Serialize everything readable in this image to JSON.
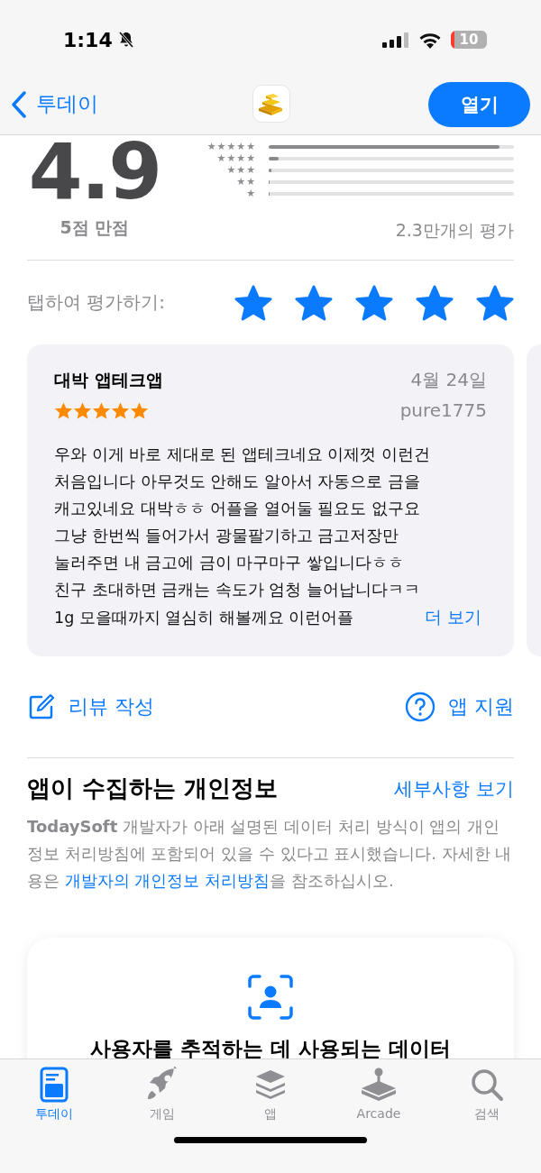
{
  "status_bar": {
    "time": "1:14",
    "battery": "10"
  },
  "nav": {
    "back": "투데이",
    "open_button": "열기"
  },
  "ratings": {
    "score": "4.9",
    "out_of": "5점 만점",
    "count": "2.3만개의 평가",
    "histogram": [
      {
        "label": "★★★★★",
        "level": 0.94
      },
      {
        "label": "★★★★",
        "level": 0.04
      },
      {
        "label": "★★★",
        "level": 0.01
      },
      {
        "label": "★★",
        "level": 0.005
      },
      {
        "label": "★",
        "level": 0.005
      }
    ]
  },
  "tap_to_rate": {
    "label": "탭하여 평가하기:",
    "stars": 5
  },
  "review": {
    "title": "대박 앱테크앱",
    "date": "4월 24일",
    "author": "pure1775",
    "stars": 5,
    "body": "우와 이게 바로 제대로 된 앱테크네요 이제껏 이런건\n처음입니다 아무것도 안해도 알아서 자동으로 금을\n캐고있네요 대박ㅎㅎ 어플을 열어둘 필요도 없구요\n그냥 한번씩 들어가서 광물팔기하고 금고저장만\n눌러주면 내 금고에 금이 마구마구 쌓입니다ㅎㅎ\n친구 초대하면 금캐는 속도가 엄청 늘어납니다ㅋㅋ\n1g 모을때까지 열심히 해볼께요 이런어플",
    "more": "더 보기"
  },
  "actions": {
    "write_review": "리뷰 작성",
    "app_support": "앱 지원"
  },
  "privacy": {
    "title": "앱이 수집하는 개인정보",
    "details_link": "세부사항 보기",
    "text_before": "**TodaySoft** 개발자가 아래 설명된 데이터 처리 방식이 앱의 개인정보 처리방침에 포함되어 있을 수 있다고 표시했습니다. 자세한 내용은 ",
    "link": "개발자의 개인정보 처리방침",
    "text_after": "을 참조하십시오.",
    "card_title": "사용자를 추적하는 데 사용되는 데이터"
  },
  "tab_bar": [
    {
      "kind": "today",
      "label": "투데이",
      "selected": true
    },
    {
      "kind": "games",
      "label": "게임",
      "selected": false
    },
    {
      "kind": "apps",
      "label": "앱",
      "selected": false
    },
    {
      "kind": "arcade",
      "label": "Arcade",
      "selected": false
    },
    {
      "kind": "search",
      "label": "검색",
      "selected": false
    }
  ]
}
